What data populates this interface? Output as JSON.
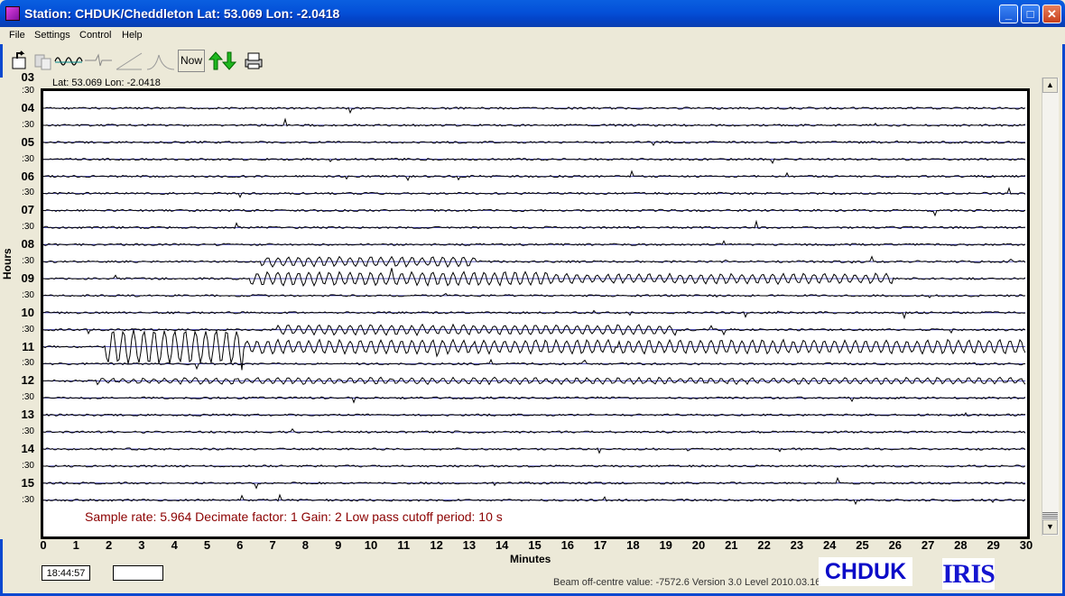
{
  "window": {
    "title": "Station: CHDUK/Cheddleton Lat: 53.069 Lon: -2.0418",
    "minimize": "_",
    "maximize": "□",
    "close": "✕"
  },
  "menu": [
    "File",
    "Settings",
    "Control",
    "Help"
  ],
  "toolbar": {
    "now_label": "Now",
    "icons": [
      "open-file-icon",
      "copy-icon",
      "waveform-icon",
      "filter-icon",
      "ramp-icon",
      "spectrum-icon",
      "up-down-arrows-icon",
      "printer-icon"
    ]
  },
  "plot": {
    "latlon": "Lat: 53.069 Lon: -2.0418",
    "y_axis_label": "Hours",
    "x_axis_label": "Minutes",
    "top_cut_label": "03",
    "rows": [
      ":30",
      "04",
      ":30",
      "05",
      ":30",
      "06",
      ":30",
      "07",
      ":30",
      "08",
      ":30",
      "09",
      ":30",
      "10",
      ":30",
      "11",
      ":30",
      "12",
      ":30",
      "13",
      ":30",
      "14",
      ":30",
      "15",
      ":30"
    ],
    "x_ticks": [
      "0",
      "1",
      "2",
      "3",
      "4",
      "5",
      "6",
      "7",
      "8",
      "9",
      "10",
      "11",
      "12",
      "13",
      "14",
      "15",
      "16",
      "17",
      "18",
      "19",
      "20",
      "21",
      "22",
      "23",
      "24",
      "25",
      "26",
      "27",
      "28",
      "29",
      "30"
    ],
    "sample_info": "Sample rate: 5.964  Decimate factor: 1  Gain: 2  Low pass cutoff period: 10 s",
    "trace_color": "#000000",
    "baseline_color": "#1a1aa0"
  },
  "status": {
    "clock": "18:44:57",
    "blank_field": "",
    "beam": "Beam off-centre value: -7572.6 Version 3.0 Level 2010.03.16",
    "station_logo": "CHDUK",
    "iris_logo": "IRIS"
  }
}
